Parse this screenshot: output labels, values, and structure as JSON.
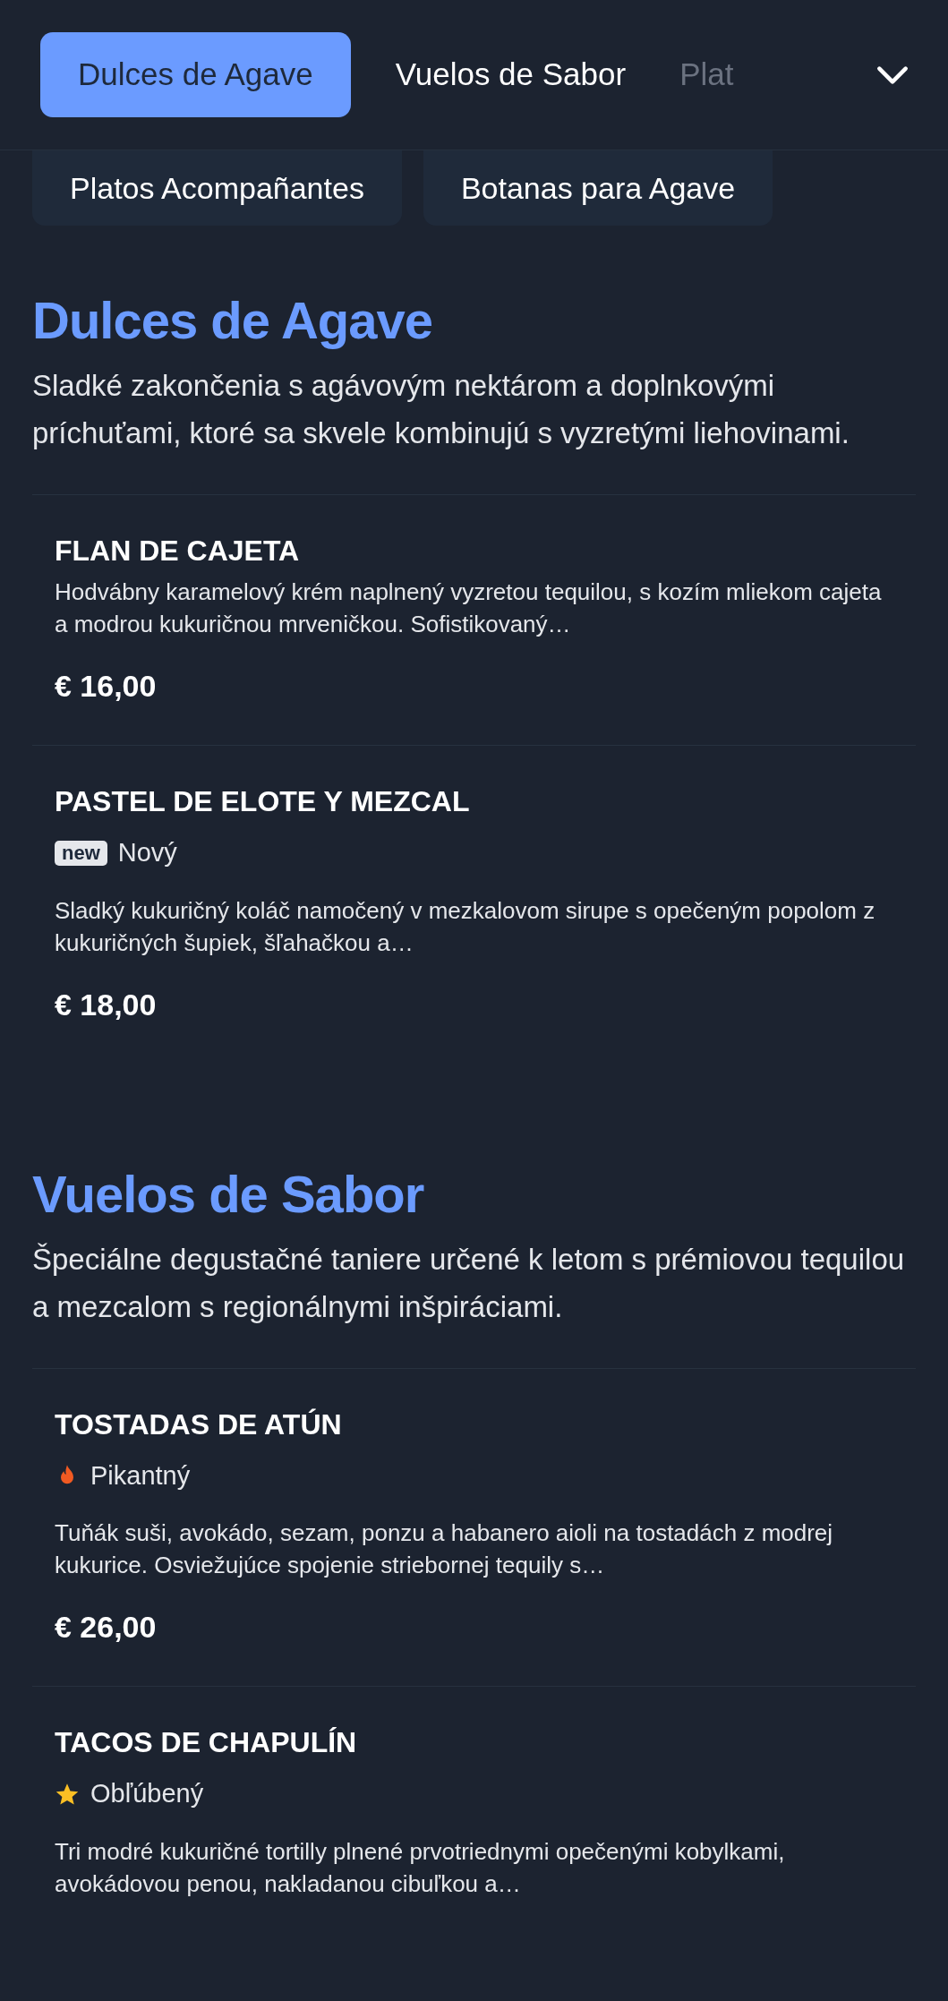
{
  "tabs": [
    {
      "label": "Dulces de Agave",
      "selected": true
    },
    {
      "label": "Vuelos de Sabor",
      "selected": false
    },
    {
      "label": "Plat",
      "selected": false
    }
  ],
  "more_tabs": [
    {
      "label": "Platos Acompañantes"
    },
    {
      "label": "Botanas para Agave"
    }
  ],
  "sections": [
    {
      "title": "Dulces de Agave",
      "description": "Sladké zakončenia s agávovým nektárom a doplnkovými príchuťami, ktoré sa skvele kombinujú s vyzretými liehovinami.",
      "items": [
        {
          "name": "FLAN DE CAJETA",
          "description": "Hodvábny karamelový krém naplnený vyzretou tequilou, s kozím mliekom cajeta a modrou kukuričnou mrveničkou. Sofistikovaný…",
          "price": "€ 16,00"
        },
        {
          "name": "PASTEL DE ELOTE Y MEZCAL",
          "tag": {
            "kind": "new",
            "badge": "new",
            "label": "Nový"
          },
          "description": "Sladký kukuričný koláč namočený v mezkalovom sirupe s opečeným popolom z kukuričných šupiek, šľahačkou a…",
          "price": "€ 18,00"
        }
      ]
    },
    {
      "title": "Vuelos de Sabor",
      "description": "Špeciálne degustačné taniere určené k letom s prémiovou tequilou a mezcalom s regionálnymi inšpiráciami.",
      "items": [
        {
          "name": "TOSTADAS DE ATÚN",
          "tag": {
            "kind": "spicy",
            "label": "Pikantný"
          },
          "description": "Tuňák suši, avokádo, sezam, ponzu a habanero aioli na tostadách z modrej kukurice. Osviežujúce spojenie striebornej tequily s…",
          "price": "€ 26,00"
        },
        {
          "name": "TACOS DE CHAPULÍN",
          "tag": {
            "kind": "popular",
            "label": "Obľúbený"
          },
          "description": "Tri modré kukuričné tortilly plnené prvotriednymi opečenými kobylkami, avokádovou penou, nakladanou cibuľkou a…"
        }
      ]
    }
  ]
}
